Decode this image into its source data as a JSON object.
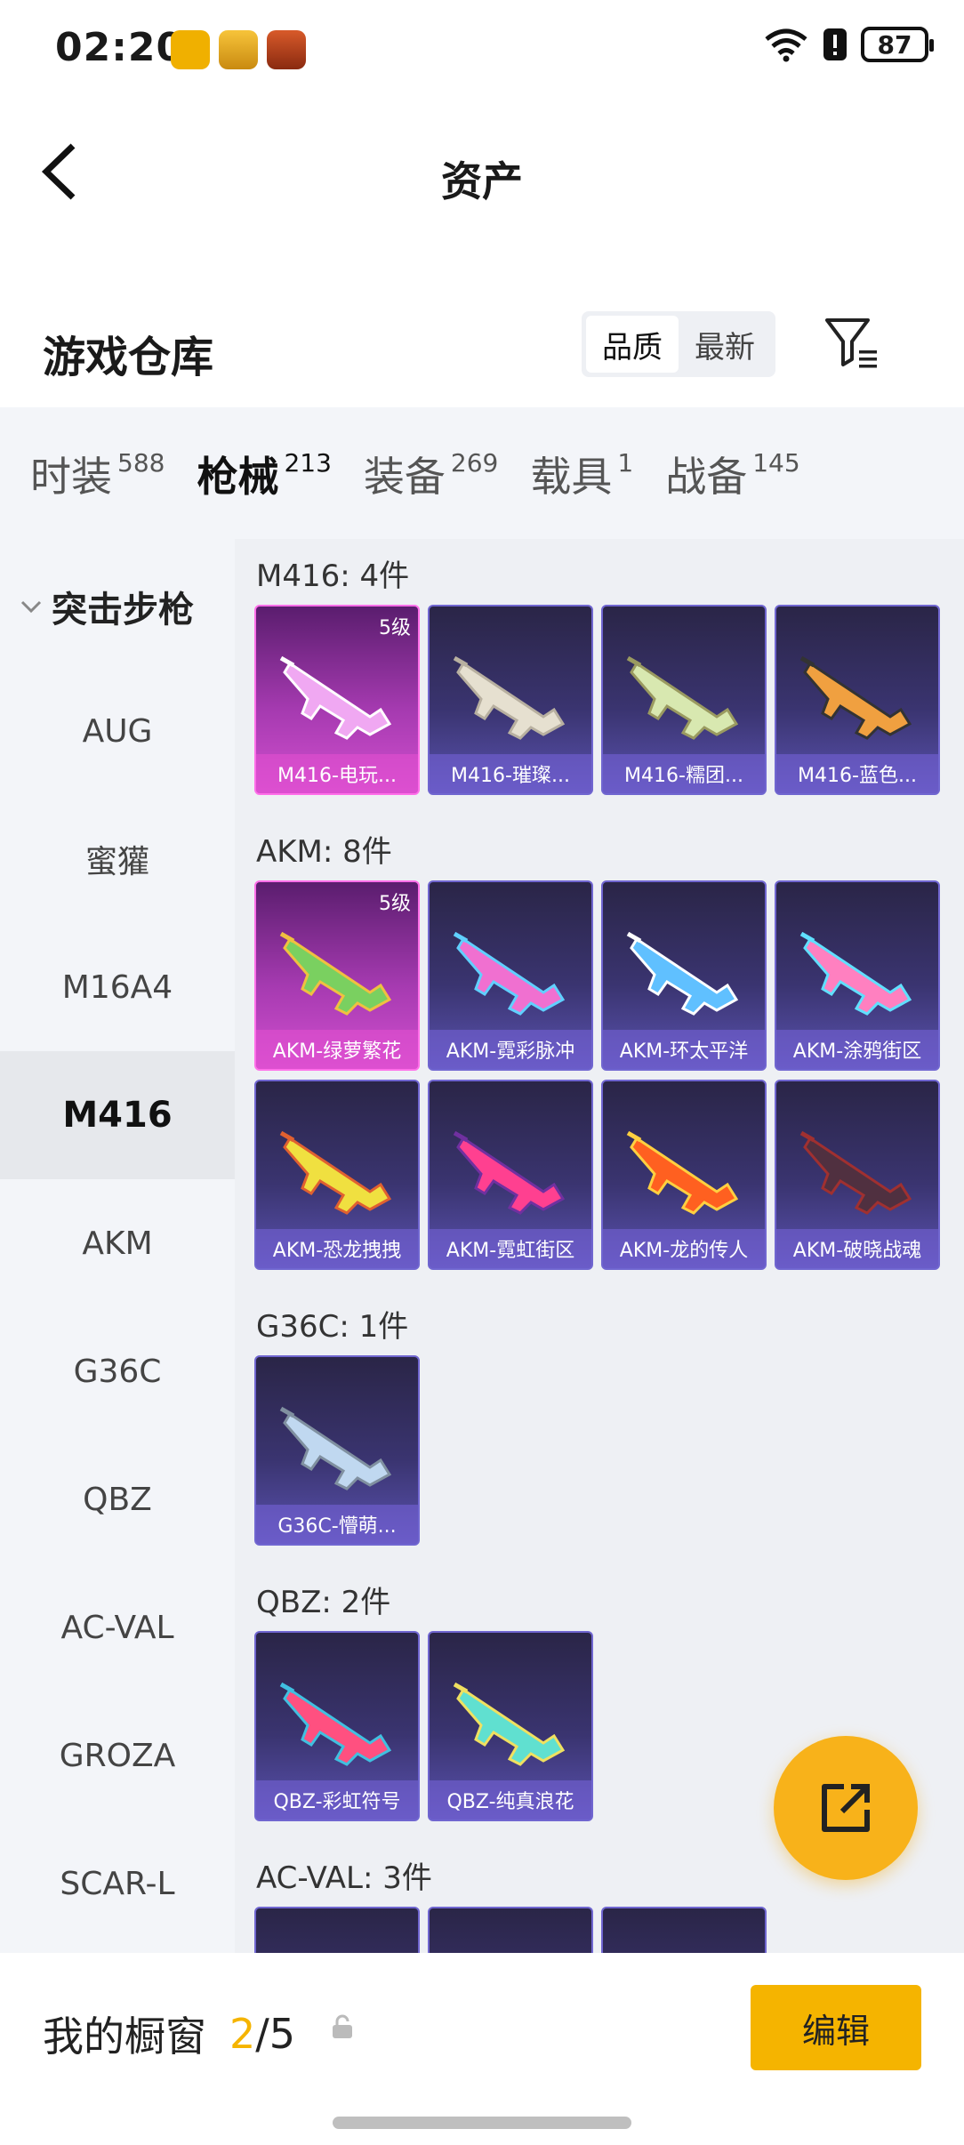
{
  "status": {
    "time": "02:20",
    "battery": "87"
  },
  "header": {
    "title": "资产"
  },
  "warehouse": {
    "title": "游戏仓库",
    "sort": [
      "品质",
      "最新"
    ]
  },
  "tabs": [
    {
      "label": "时装",
      "count": "588"
    },
    {
      "label": "枪械",
      "count": "213"
    },
    {
      "label": "装备",
      "count": "269"
    },
    {
      "label": "载具",
      "count": "1"
    },
    {
      "label": "战备",
      "count": "145"
    }
  ],
  "sidebar": {
    "group": "突击步枪",
    "items": [
      "AUG",
      "蜜獾",
      "M16A4",
      "M416",
      "AKM",
      "G36C",
      "QBZ",
      "AC-VAL",
      "GROZA",
      "SCAR-L"
    ]
  },
  "sections": [
    {
      "title": "M416: 4件",
      "cards": [
        {
          "name": "M416-电玩...",
          "level": "5级",
          "gold": true
        },
        {
          "name": "M416-璀璨...",
          "level": "",
          "gold": false
        },
        {
          "name": "M416-糯团...",
          "level": "",
          "gold": false
        },
        {
          "name": "M416-蓝色...",
          "level": "",
          "gold": false
        }
      ]
    },
    {
      "title": "AKM: 8件",
      "cards": [
        {
          "name": "AKM-绿萝繁花",
          "level": "5级",
          "gold": true
        },
        {
          "name": "AKM-霓彩脉冲",
          "level": "",
          "gold": false
        },
        {
          "name": "AKM-环太平洋",
          "level": "",
          "gold": false
        },
        {
          "name": "AKM-涂鸦街区",
          "level": "",
          "gold": false
        },
        {
          "name": "AKM-恐龙拽拽",
          "level": "",
          "gold": false
        },
        {
          "name": "AKM-霓虹街区",
          "level": "",
          "gold": false
        },
        {
          "name": "AKM-龙的传人",
          "level": "",
          "gold": false
        },
        {
          "name": "AKM-破晓战魂",
          "level": "",
          "gold": false
        }
      ]
    },
    {
      "title": "G36C: 1件",
      "cards": [
        {
          "name": "G36C-懵萌...",
          "level": "",
          "gold": false
        }
      ]
    },
    {
      "title": "QBZ: 2件",
      "cards": [
        {
          "name": "QBZ-彩虹符号",
          "level": "",
          "gold": false
        },
        {
          "name": "QBZ-纯真浪花",
          "level": "",
          "gold": false
        }
      ]
    },
    {
      "title": "AC-VAL: 3件",
      "cards": [
        {
          "name": "",
          "level": "",
          "gold": false
        },
        {
          "name": "",
          "level": "",
          "gold": false
        },
        {
          "name": "",
          "level": "",
          "gold": false
        }
      ]
    }
  ],
  "showcase": {
    "label": "我的橱窗",
    "current": "2",
    "total": "/5",
    "edit": "编辑"
  }
}
